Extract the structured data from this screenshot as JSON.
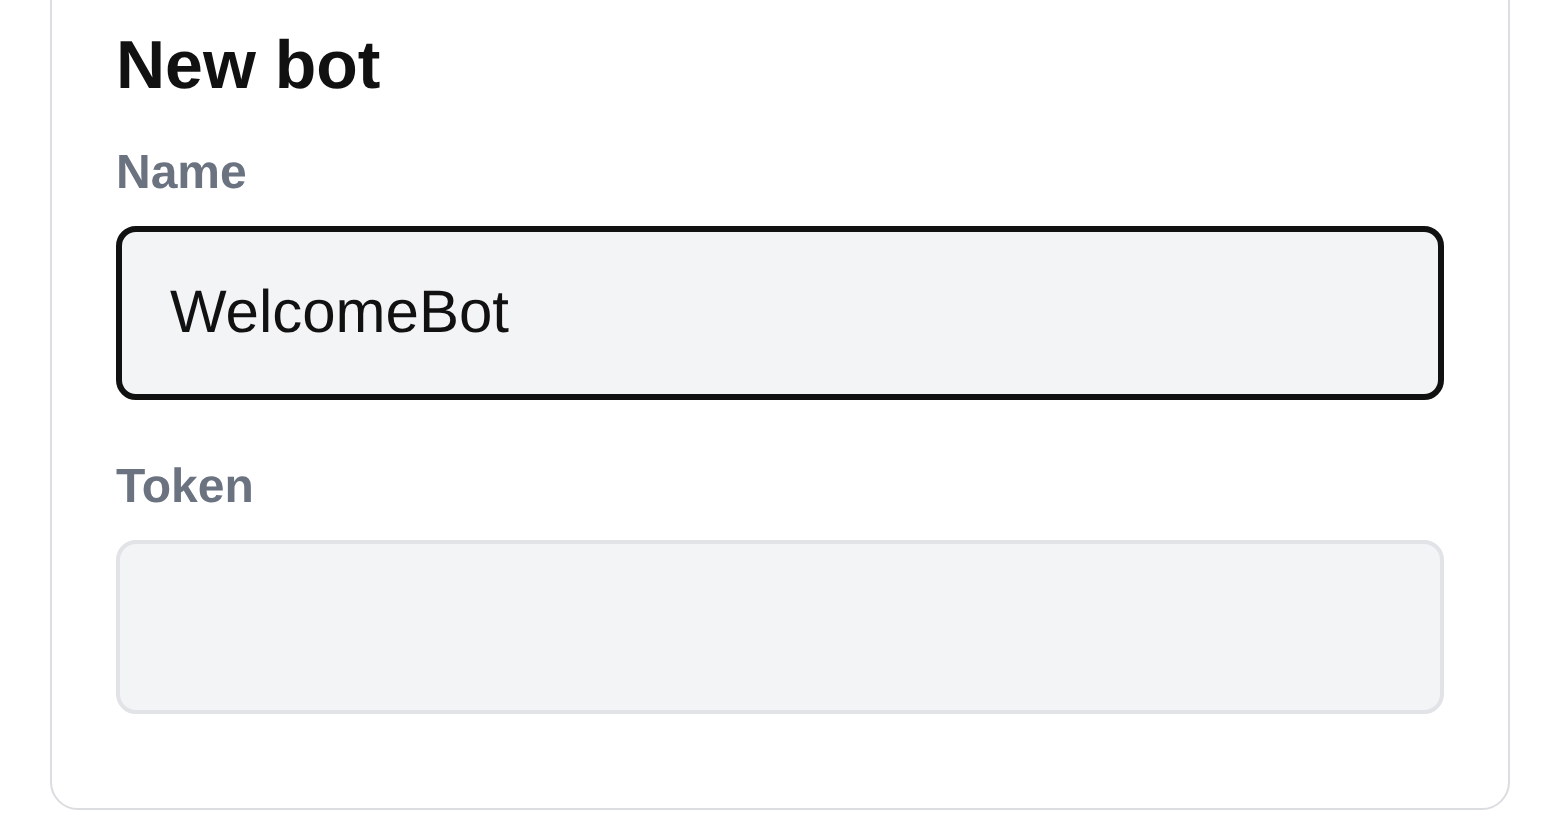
{
  "card": {
    "title": "New bot",
    "fields": [
      {
        "label": "Name",
        "value": "WelcomeBot",
        "focused": true
      },
      {
        "label": "Token",
        "focused": false
      }
    ]
  }
}
